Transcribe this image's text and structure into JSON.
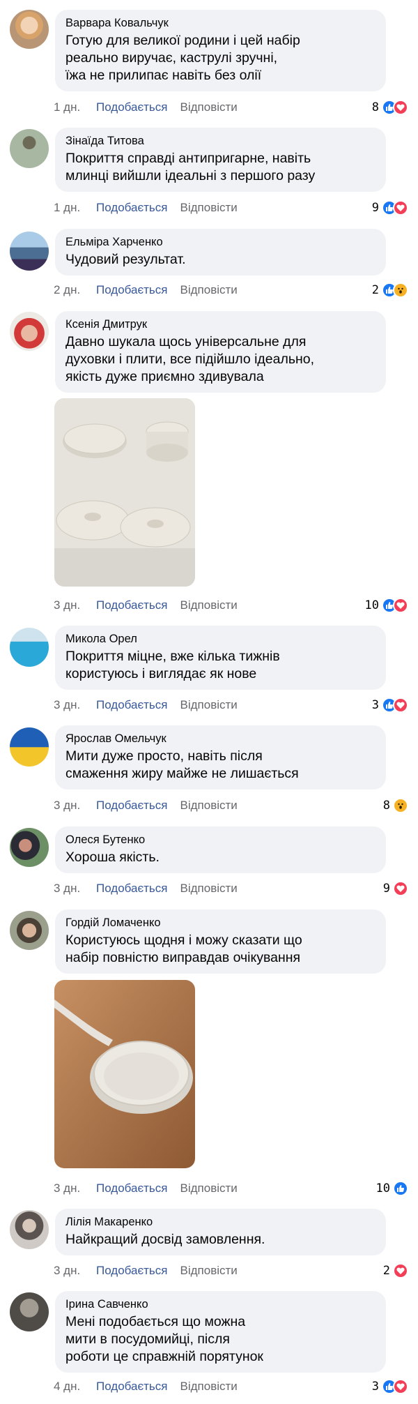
{
  "colors": {
    "link": "#385898",
    "muted": "#65676b",
    "bubble": "#f0f2f5",
    "like": "#1877f2",
    "love": "#f33e58",
    "wow": "#f7b125"
  },
  "actions": {
    "like": "Подобається",
    "reply": "Відповісти"
  },
  "comments": [
    {
      "author": "Варвара Ковальчук",
      "text": "Готую для великої родини і цей набір\nреально виручає, каструлі зручні,\nїжа не прилипає навіть без олії",
      "time": "1 дн.",
      "count": "8",
      "reactions": [
        "like-icon",
        "love-icon"
      ]
    },
    {
      "author": "Зінаїда Титова",
      "text": "Покриття справді антипригарне, навіть\nмлинці вийшли ідеальні з першого разу",
      "time": "1 дн.",
      "count": "9",
      "reactions": [
        "like-icon",
        "love-icon"
      ]
    },
    {
      "author": "Ельміра Харченко",
      "text": "Чудовий результат.",
      "time": "2 дн.",
      "count": "2",
      "reactions": [
        "like-icon",
        "wow-icon"
      ]
    },
    {
      "author": "Ксенія Дмитрук",
      "text": "Давно шукала щось універсальне для\nдуховки і плити, все підійшло ідеально,\nякість дуже приємно здивувала",
      "time": "3 дн.",
      "count": "10",
      "reactions": [
        "like-icon",
        "love-icon"
      ],
      "photo": "cookware-set-photo"
    },
    {
      "author": "Микола Орел",
      "text": "Покриття міцне, вже кілька тижнів\nкористуюсь і виглядає як нове",
      "time": "3 дн.",
      "count": "3",
      "reactions": [
        "like-icon",
        "love-icon"
      ]
    },
    {
      "author": "Ярослав Омельчук",
      "text": "Мити дуже просто, навіть після\nсмаження жиру майже не лишається",
      "time": "3 дн.",
      "count": "8",
      "reactions": [
        "wow-icon"
      ]
    },
    {
      "author": "Олеся Бутенко",
      "text": "Хороша якість.",
      "time": "3 дн.",
      "count": "9",
      "reactions": [
        "love-icon"
      ]
    },
    {
      "author": "Гордій Ломаченко",
      "text": "Користуюсь щодня і можу сказати що\nнабір повністю виправдав очікування",
      "time": "3 дн.",
      "count": "10",
      "reactions": [
        "like-icon"
      ],
      "photo": "frying-pan-photo"
    },
    {
      "author": "Лілія Макаренко",
      "text": "Найкращий досвід замовлення.",
      "time": "3 дн.",
      "count": "2",
      "reactions": [
        "love-icon"
      ]
    },
    {
      "author": "Ірина Савченко",
      "text": "Мені подобається що можна\nмити в посудомийці, після\nроботи це справжній порятунок",
      "time": "4 дн.",
      "count": "3",
      "reactions": [
        "like-icon",
        "love-icon"
      ]
    }
  ]
}
